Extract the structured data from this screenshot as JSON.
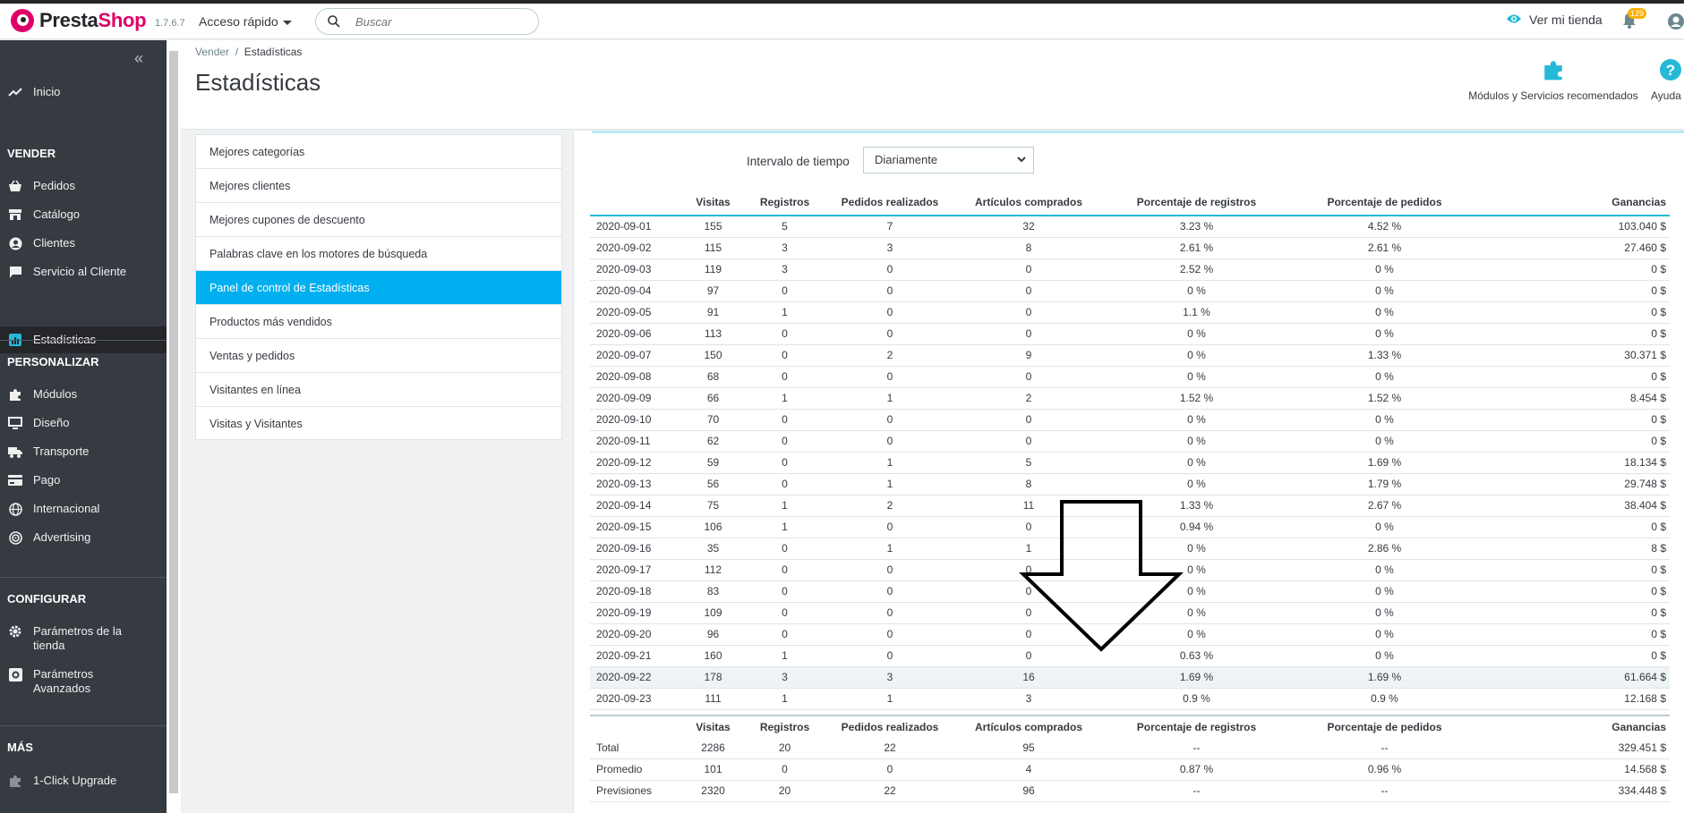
{
  "header": {
    "brand_presta": "Presta",
    "brand_shop": "Shop",
    "version": "1.7.6.7",
    "quick_access": "Acceso rápido",
    "search_placeholder": "Buscar",
    "view_store": "Ver mi tienda",
    "notifications_count": "129"
  },
  "sidebar": {
    "home": "Inicio",
    "sections": {
      "sell": "VENDER",
      "customize": "PERSONALIZAR",
      "configure": "CONFIGURAR",
      "more": "MÁS"
    },
    "sell_items": [
      "Pedidos",
      "Catálogo",
      "Clientes",
      "Servicio al Cliente",
      "Estadísticas"
    ],
    "customize_items": [
      "Módulos",
      "Diseño",
      "Transporte",
      "Pago",
      "Internacional",
      "Advertising"
    ],
    "configure_items": [
      "Parámetros de la tienda",
      "Parámetros Avanzados"
    ],
    "more_items": [
      "1-Click Upgrade"
    ]
  },
  "page": {
    "breadcrumb_parent": "Vender",
    "breadcrumb_sep": "/",
    "breadcrumb_current": "Estadísticas",
    "title": "Estadísticas",
    "toolbar_modules": "Módulos y Servicios recomendados",
    "toolbar_help": "Ayuda"
  },
  "stats_menu": [
    "Mejores categorías",
    "Mejores clientes",
    "Mejores cupones de descuento",
    "Palabras clave en los motores de búsqueda",
    "Panel de control de Estadísticas",
    "Productos más vendidos",
    "Ventas y pedidos",
    "Visitantes en línea",
    "Visitas y Visitantes"
  ],
  "stats_menu_active": 4,
  "interval": {
    "label": "Intervalo de tiempo",
    "selected": "Diariamente"
  },
  "table": {
    "headers": [
      "",
      "Visitas",
      "Registros",
      "Pedidos realizados",
      "Artículos comprados",
      "Porcentaje de registros",
      "Porcentaje de pedidos",
      "Ganancias"
    ],
    "rows": [
      [
        "2020-09-01",
        "155",
        "5",
        "7",
        "32",
        "3.23 %",
        "4.52 %",
        "103.040 $"
      ],
      [
        "2020-09-02",
        "115",
        "3",
        "3",
        "8",
        "2.61 %",
        "2.61 %",
        "27.460 $"
      ],
      [
        "2020-09-03",
        "119",
        "3",
        "0",
        "0",
        "2.52 %",
        "0 %",
        "0 $"
      ],
      [
        "2020-09-04",
        "97",
        "0",
        "0",
        "0",
        "0 %",
        "0 %",
        "0 $"
      ],
      [
        "2020-09-05",
        "91",
        "1",
        "0",
        "0",
        "1.1 %",
        "0 %",
        "0 $"
      ],
      [
        "2020-09-06",
        "113",
        "0",
        "0",
        "0",
        "0 %",
        "0 %",
        "0 $"
      ],
      [
        "2020-09-07",
        "150",
        "0",
        "2",
        "9",
        "0 %",
        "1.33 %",
        "30.371 $"
      ],
      [
        "2020-09-08",
        "68",
        "0",
        "0",
        "0",
        "0 %",
        "0 %",
        "0 $"
      ],
      [
        "2020-09-09",
        "66",
        "1",
        "1",
        "2",
        "1.52 %",
        "1.52 %",
        "8.454 $"
      ],
      [
        "2020-09-10",
        "70",
        "0",
        "0",
        "0",
        "0 %",
        "0 %",
        "0 $"
      ],
      [
        "2020-09-11",
        "62",
        "0",
        "0",
        "0",
        "0 %",
        "0 %",
        "0 $"
      ],
      [
        "2020-09-12",
        "59",
        "0",
        "1",
        "5",
        "0 %",
        "1.69 %",
        "18.134 $"
      ],
      [
        "2020-09-13",
        "56",
        "0",
        "1",
        "8",
        "0 %",
        "1.79 %",
        "29.748 $"
      ],
      [
        "2020-09-14",
        "75",
        "1",
        "2",
        "11",
        "1.33 %",
        "2.67 %",
        "38.404 $"
      ],
      [
        "2020-09-15",
        "106",
        "1",
        "0",
        "0",
        "0.94 %",
        "0 %",
        "0 $"
      ],
      [
        "2020-09-16",
        "35",
        "0",
        "1",
        "1",
        "0 %",
        "2.86 %",
        "8 $"
      ],
      [
        "2020-09-17",
        "112",
        "0",
        "0",
        "0",
        "0 %",
        "0 %",
        "0 $"
      ],
      [
        "2020-09-18",
        "83",
        "0",
        "0",
        "0",
        "0 %",
        "0 %",
        "0 $"
      ],
      [
        "2020-09-19",
        "109",
        "0",
        "0",
        "0",
        "0 %",
        "0 %",
        "0 $"
      ],
      [
        "2020-09-20",
        "96",
        "0",
        "0",
        "0",
        "0 %",
        "0 %",
        "0 $"
      ],
      [
        "2020-09-21",
        "160",
        "1",
        "0",
        "0",
        "0.63 %",
        "0 %",
        "0 $"
      ],
      [
        "2020-09-22",
        "178",
        "3",
        "3",
        "16",
        "1.69 %",
        "1.69 %",
        "61.664 $"
      ],
      [
        "2020-09-23",
        "111",
        "1",
        "1",
        "3",
        "0.9 %",
        "0.9 %",
        "12.168 $"
      ]
    ],
    "highlight_row": 21
  },
  "totals": {
    "headers": [
      "",
      "Visitas",
      "Registros",
      "Pedidos realizados",
      "Artículos comprados",
      "Porcentaje de registros",
      "Porcentaje de pedidos",
      "Ganancias"
    ],
    "rows": [
      [
        "Total",
        "2286",
        "20",
        "22",
        "95",
        "--",
        "--",
        "329.451 $"
      ],
      [
        "Promedio",
        "101",
        "0",
        "0",
        "4",
        "0.87 %",
        "0.96 %",
        "14.568 $"
      ],
      [
        "Previsiones",
        "2320",
        "20",
        "22",
        "96",
        "--",
        "--",
        "334.448 $"
      ]
    ]
  },
  "colors": {
    "sidebar_bg": "#363a41",
    "accent": "#25b9d7",
    "active_menu": "#00aff0",
    "brand": "#df0067"
  }
}
